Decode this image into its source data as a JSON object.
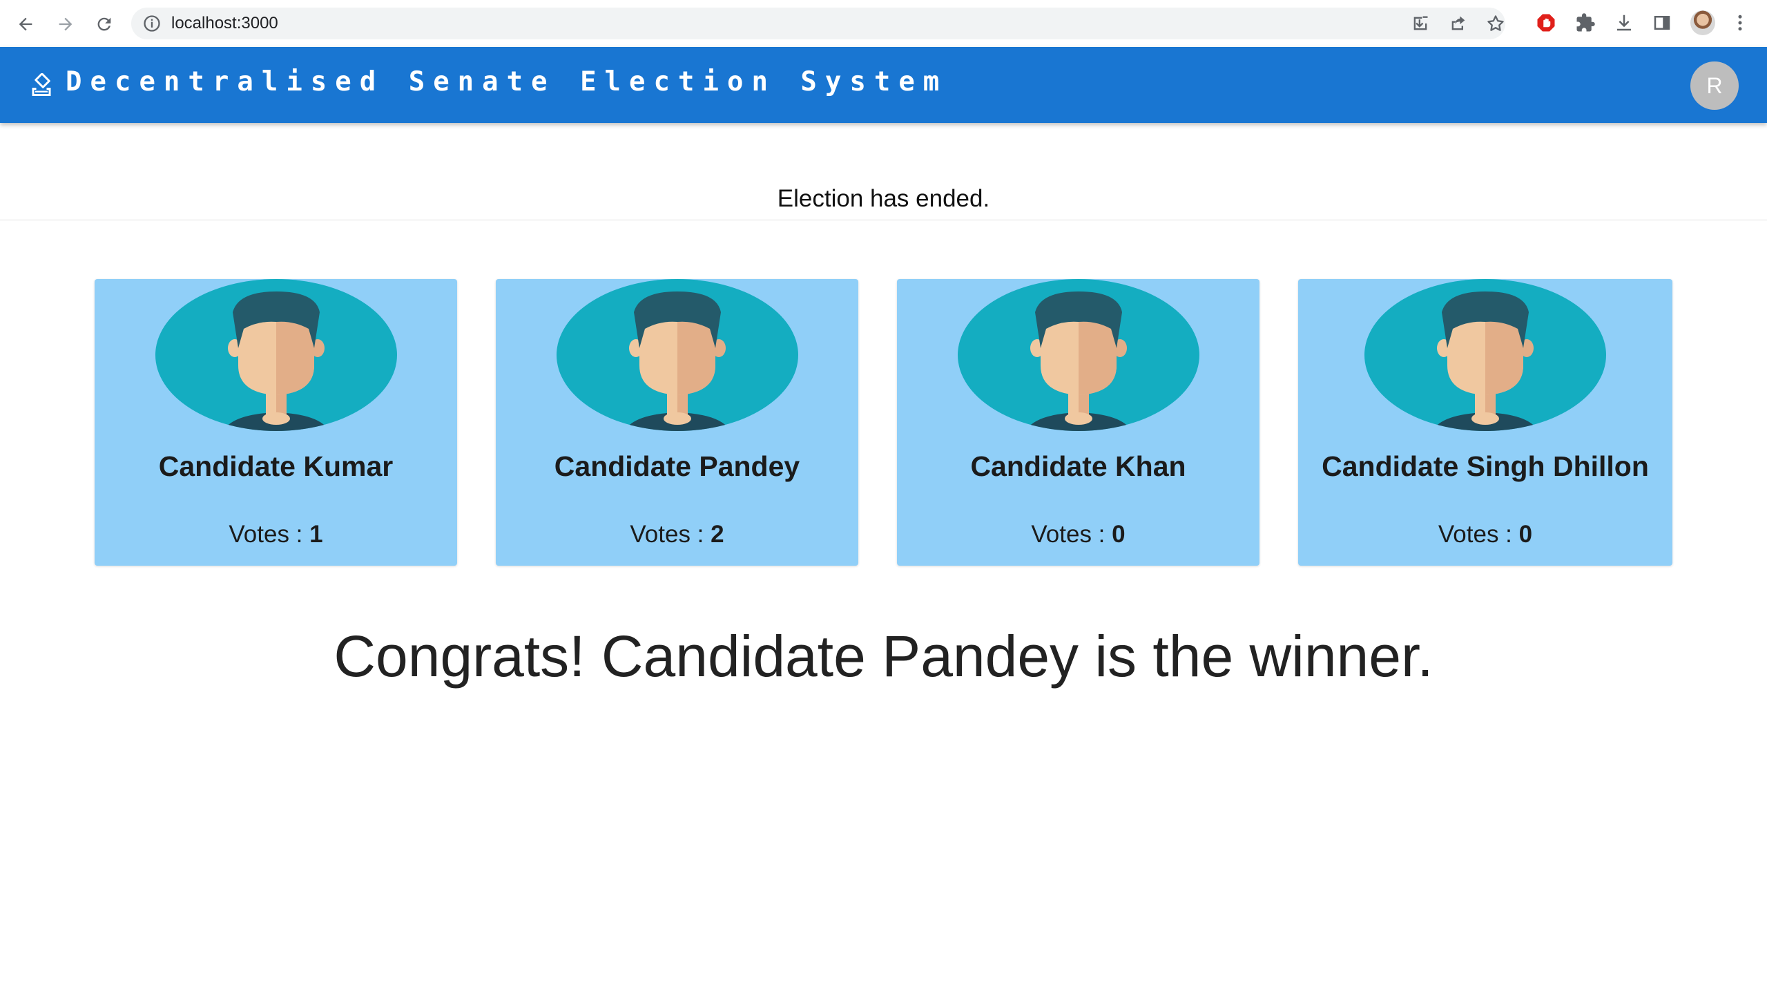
{
  "browser": {
    "url": "localhost:3000"
  },
  "app": {
    "title": "Decentralised Senate Election System",
    "avatar_initial": "R",
    "header_color": "#1976d2"
  },
  "status_text": "Election has ended.",
  "candidates": [
    {
      "name": "Candidate Kumar",
      "votes_label": "Votes :",
      "votes": "1"
    },
    {
      "name": "Candidate Pandey",
      "votes_label": "Votes :",
      "votes": "2"
    },
    {
      "name": "Candidate Khan",
      "votes_label": "Votes :",
      "votes": "0"
    },
    {
      "name": "Candidate Singh Dhillon",
      "votes_label": "Votes :",
      "votes": "0"
    }
  ],
  "winner_text": "Congrats! Candidate Pandey is the winner.",
  "colors": {
    "card_bg": "#90cff8",
    "avatar_circle": "#14adc1",
    "hair": "#245a6a",
    "skin_light": "#f0c8a0",
    "skin_dark": "#e2ae88",
    "shirt": "#1f4a5c"
  },
  "icons": [
    "back-icon",
    "forward-icon",
    "reload-icon",
    "info-icon",
    "install-icon",
    "share-icon",
    "star-icon",
    "adblock-icon",
    "extensions-icon",
    "download-icon",
    "sidepanel-icon",
    "menu-icon",
    "ballot-icon"
  ]
}
